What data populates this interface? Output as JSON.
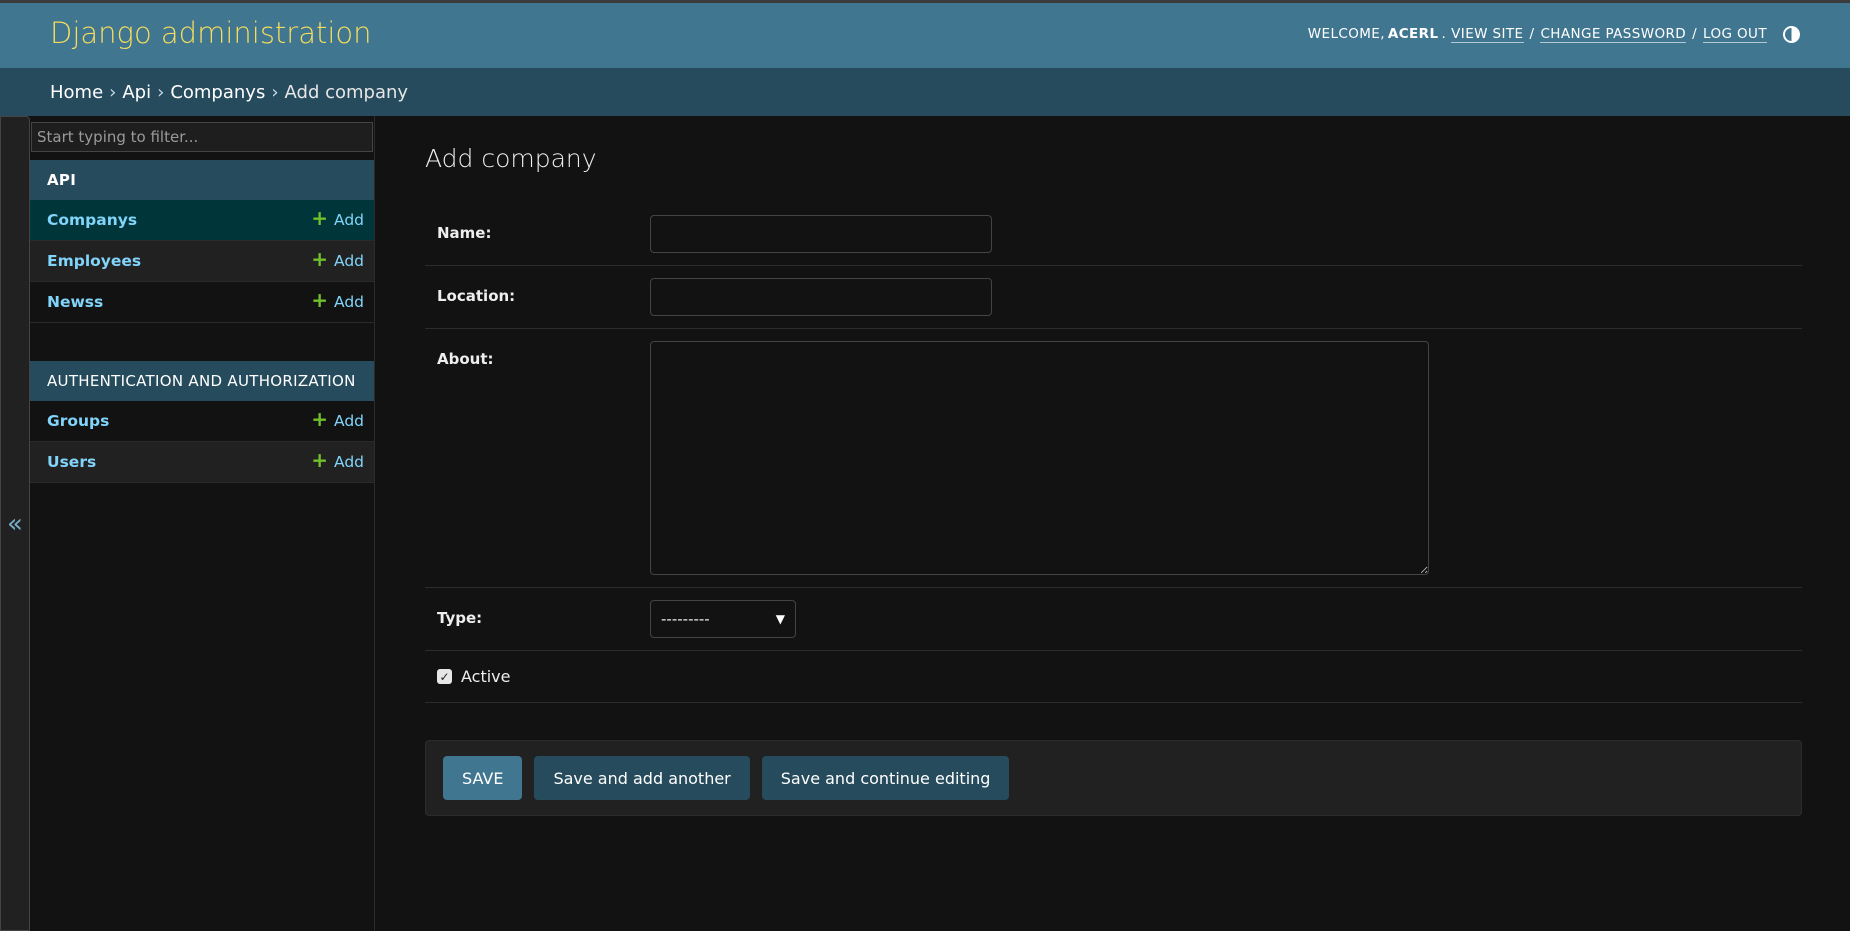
{
  "header": {
    "site_name": "Django administration",
    "welcome": "WELCOME,",
    "username": "ACERL",
    "view_site": "VIEW SITE",
    "change_password": "CHANGE PASSWORD",
    "log_out": "LOG OUT",
    "theme_icon": "contrast-icon"
  },
  "breadcrumbs": {
    "home": "Home",
    "app": "Api",
    "model": "Companys",
    "current": "Add company"
  },
  "sidebar": {
    "collapse_glyph": "«",
    "filter_placeholder": "Start typing to filter...",
    "apps": [
      {
        "caption": "API",
        "models": [
          {
            "name": "Companys",
            "add": "Add"
          },
          {
            "name": "Employees",
            "add": "Add"
          },
          {
            "name": "Newss",
            "add": "Add"
          }
        ]
      },
      {
        "caption": "AUTHENTICATION AND AUTHORIZATION",
        "models": [
          {
            "name": "Groups",
            "add": "Add"
          },
          {
            "name": "Users",
            "add": "Add"
          }
        ]
      }
    ]
  },
  "form": {
    "title": "Add company",
    "name_label": "Name:",
    "name_value": "",
    "location_label": "Location:",
    "location_value": "",
    "about_label": "About:",
    "about_value": "",
    "type_label": "Type:",
    "type_selected": "---------",
    "active_label": "Active",
    "active_checked": true
  },
  "buttons": {
    "save": "SAVE",
    "save_add_another": "Save and add another",
    "save_continue": "Save and continue editing"
  },
  "colors": {
    "header_bg": "#417690",
    "breadcrumb_bg": "#264b5d",
    "site_name": "#f5dd5d",
    "link": "#81d4fa",
    "add_icon": "#70bf2b",
    "background": "#121212"
  }
}
